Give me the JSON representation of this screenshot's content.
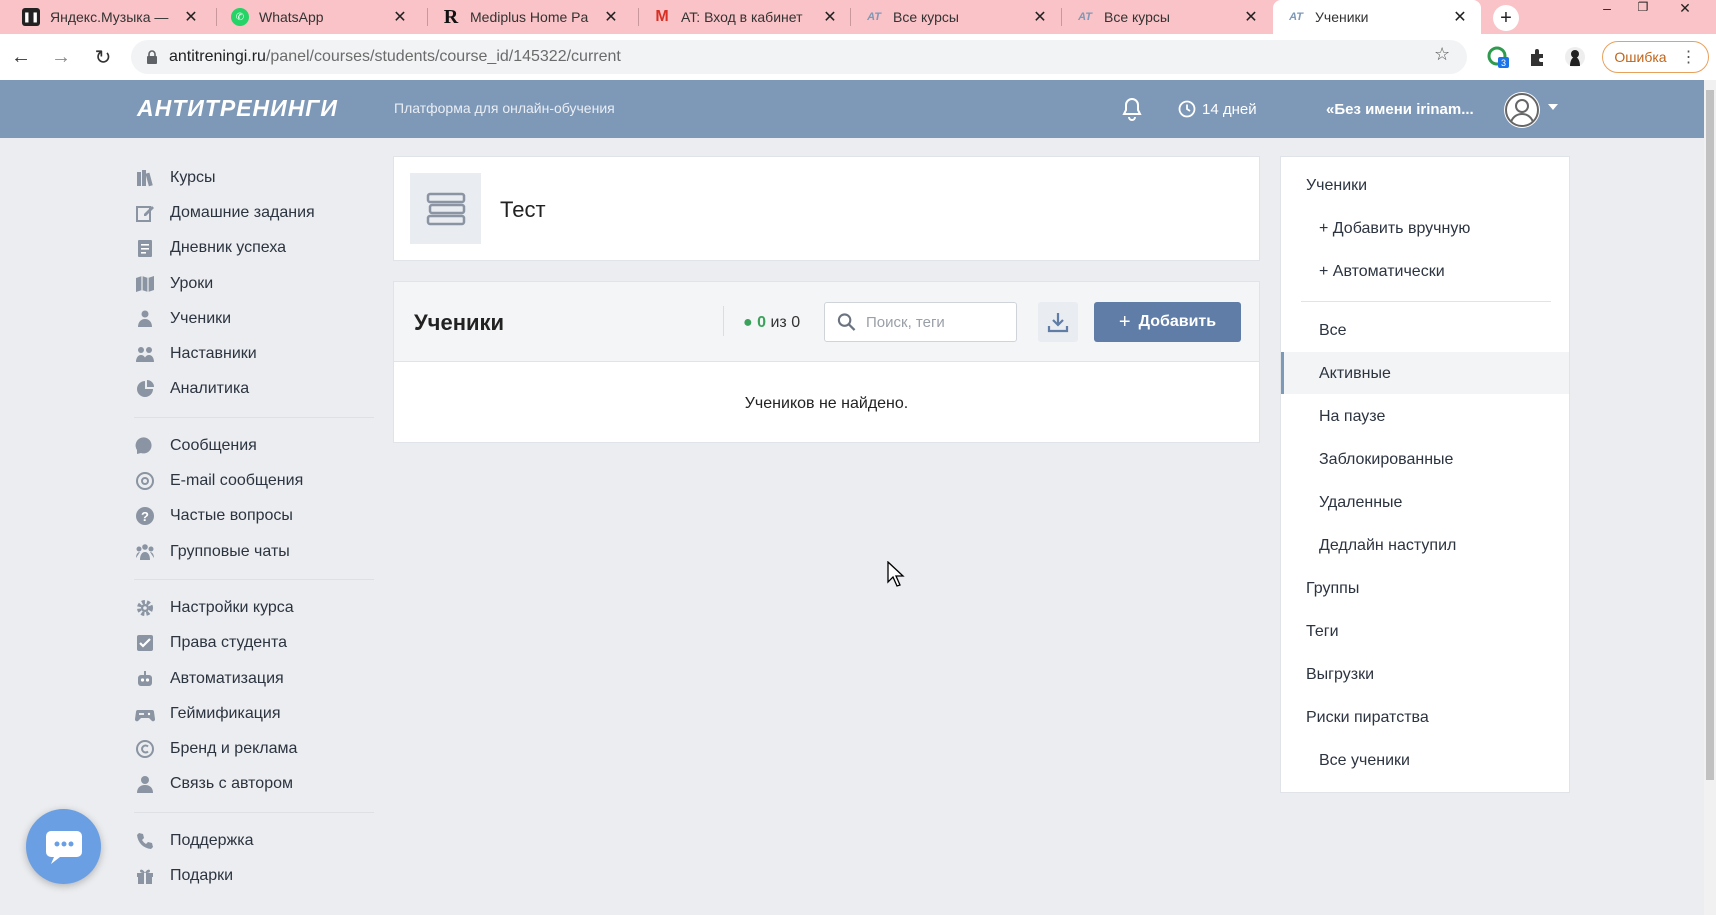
{
  "browser": {
    "tabs": [
      {
        "title": "Яндекс.Музыка —",
        "icon": "pause-icon"
      },
      {
        "title": "WhatsApp",
        "icon": "whatsapp-icon"
      },
      {
        "title": "Mediplus Home Pa",
        "icon": "r-letter-icon"
      },
      {
        "title": "AT: Вход в кабинет",
        "icon": "gmail-icon"
      },
      {
        "title": "Все курсы",
        "icon": "at-icon"
      },
      {
        "title": "Все курсы",
        "icon": "at-icon"
      },
      {
        "title": "Ученики",
        "icon": "at-icon"
      }
    ],
    "url_host": "antitreningi.ru",
    "url_path": "/panel/courses/students/course_id/145322/current",
    "extension_badge": "3",
    "error_label": "Ошибка"
  },
  "header": {
    "logo": "АНТИТРЕНИНГИ",
    "tagline": "Платформа для онлайн-обучения",
    "days_left": "14 дней",
    "username": "«Без имени irinam..."
  },
  "sidebar": {
    "group1": [
      {
        "label": "Курсы",
        "icon": "books-icon"
      },
      {
        "label": "Домашние задания",
        "icon": "edit-icon"
      },
      {
        "label": "Дневник успеха",
        "icon": "diary-icon"
      },
      {
        "label": "Уроки",
        "icon": "lessons-icon"
      },
      {
        "label": "Ученики",
        "icon": "students-icon"
      },
      {
        "label": "Наставники",
        "icon": "mentors-icon"
      },
      {
        "label": "Аналитика",
        "icon": "pie-chart-icon"
      }
    ],
    "group2": [
      {
        "label": "Сообщения",
        "icon": "messages-icon"
      },
      {
        "label": "E-mail сообщения",
        "icon": "at-sign-icon"
      },
      {
        "label": "Частые вопросы",
        "icon": "question-icon"
      },
      {
        "label": "Групповые чаты",
        "icon": "group-chat-icon"
      }
    ],
    "group3": [
      {
        "label": "Настройки курса",
        "icon": "gear-icon"
      },
      {
        "label": "Права студента",
        "icon": "checkbox-icon"
      },
      {
        "label": "Автоматизация",
        "icon": "robot-icon"
      },
      {
        "label": "Геймификация",
        "icon": "gamepad-icon"
      },
      {
        "label": "Бренд и реклама",
        "icon": "copyright-icon"
      },
      {
        "label": "Связь с автором",
        "icon": "user-icon"
      }
    ],
    "group4": [
      {
        "label": "Поддержка",
        "icon": "phone-icon"
      },
      {
        "label": "Подарки",
        "icon": "gift-icon"
      }
    ]
  },
  "course": {
    "title": "Тест"
  },
  "students": {
    "title": "Ученики",
    "count_active": "0",
    "count_total_text": "из 0",
    "search_placeholder": "Поиск, теги",
    "add_label": "Добавить",
    "empty_text": "Учеников не найдено."
  },
  "right_panel": {
    "students": "Ученики",
    "add_manual": "+ Добавить вручную",
    "add_auto": "+ Автоматически",
    "filters": [
      "Все",
      "Активные",
      "На паузе",
      "Заблокированные",
      "Удаленные",
      "Дедлайн наступил"
    ],
    "active_filter": "Активные",
    "groups": "Группы",
    "tags": "Теги",
    "exports": "Выгрузки",
    "piracy": "Риски пиратства",
    "all_students": "Все ученики"
  },
  "colors": {
    "tabbar": "#f9c3c7",
    "header": "#7e98b7",
    "button": "#5f7da6",
    "active_count": "#3aa25b"
  }
}
